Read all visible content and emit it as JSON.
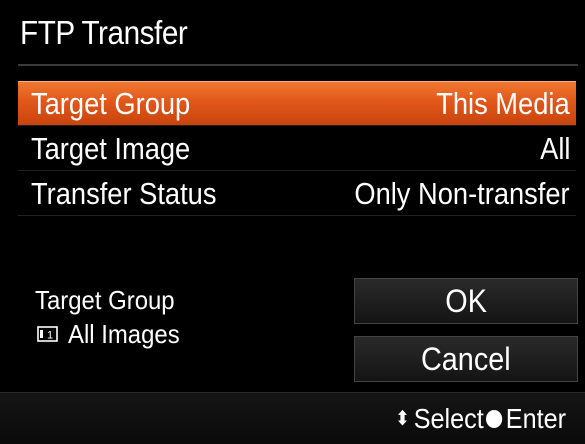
{
  "header": {
    "title": "FTP Transfer"
  },
  "menu": {
    "items": [
      {
        "label": "Target Group",
        "value": "This Media",
        "selected": true
      },
      {
        "label": "Target Image",
        "value": "All",
        "selected": false
      },
      {
        "label": "Transfer Status",
        "value": "Only Non-transfer",
        "selected": false
      }
    ]
  },
  "info": {
    "label": "Target Group",
    "value": "All Images",
    "icon": "media-slot-1-icon"
  },
  "buttons": {
    "ok": "OK",
    "cancel": "Cancel"
  },
  "footer": {
    "select_label": "Select",
    "select_icon": "up-down-arrows-icon",
    "enter_label": "Enter",
    "enter_icon": "center-button-icon"
  },
  "colors": {
    "highlight": "#e1581b",
    "background": "#000000",
    "text": "#ffffff"
  }
}
